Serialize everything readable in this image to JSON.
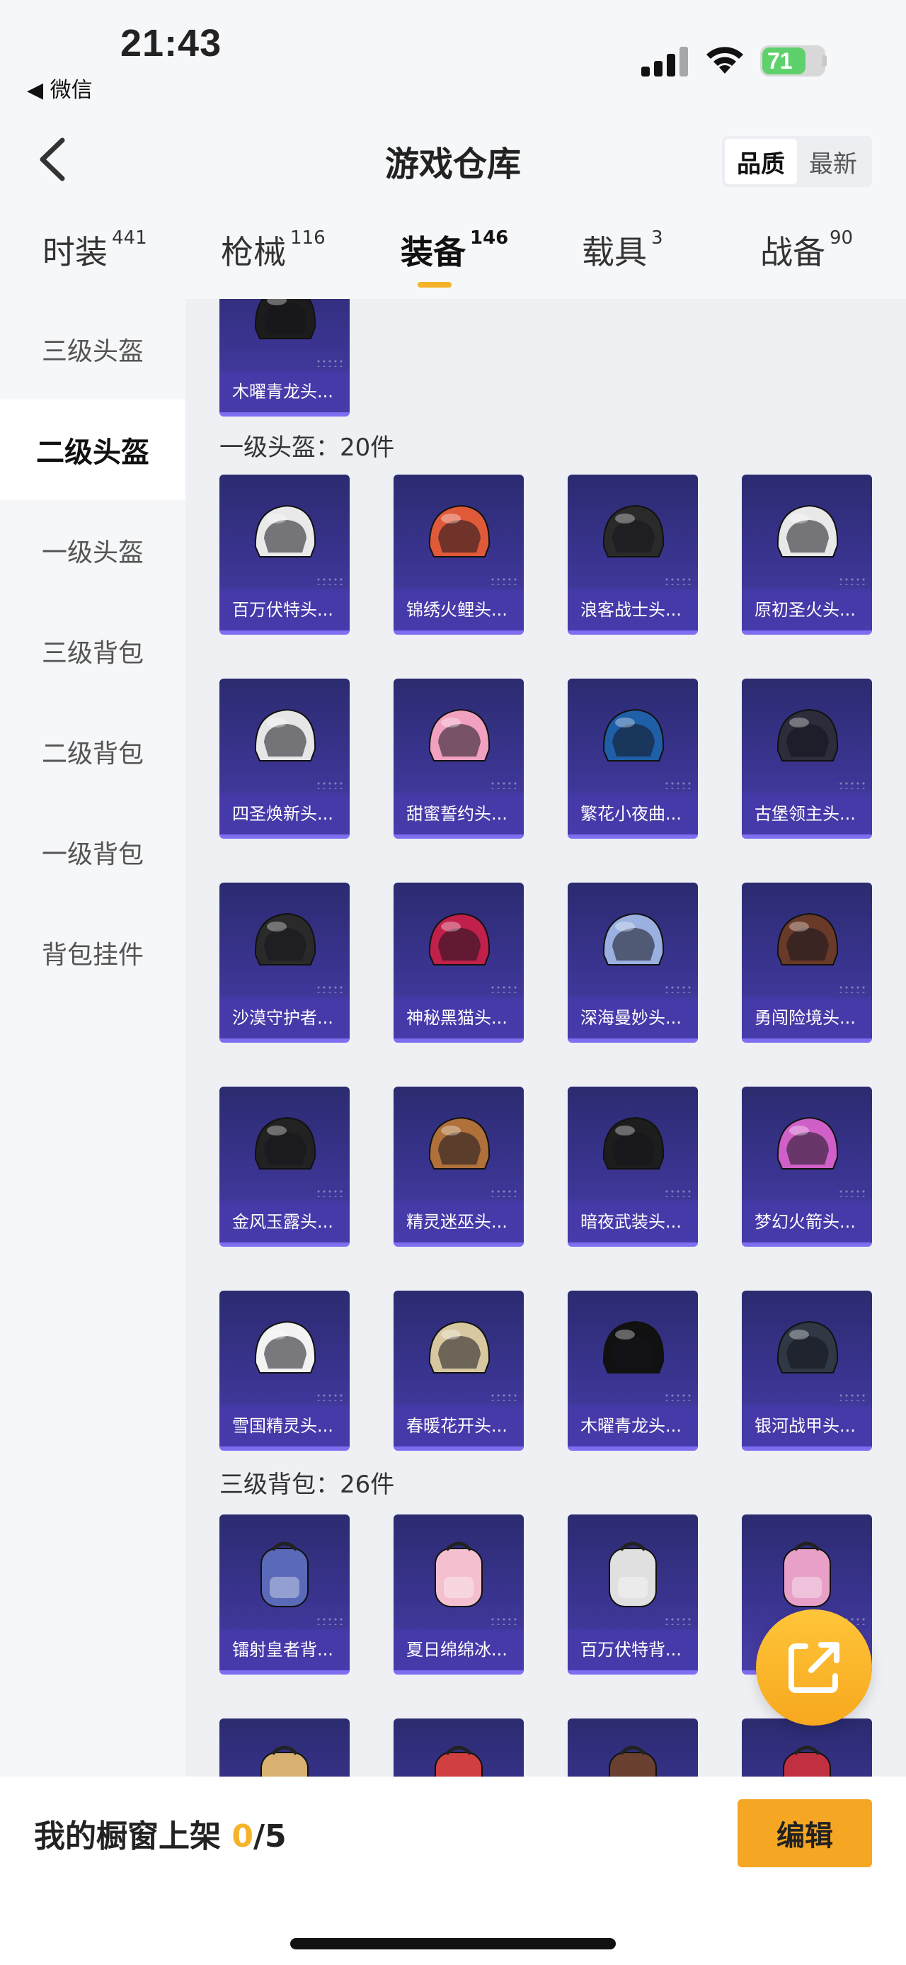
{
  "status_bar": {
    "time": "21:43",
    "back_app": "◀ 微信",
    "battery": "71",
    "battery_level": 0.71
  },
  "header": {
    "title": "游戏仓库",
    "sort_options": [
      "品质",
      "最新"
    ],
    "sort_active": "品质"
  },
  "tabs": [
    {
      "label": "时装",
      "count": "441"
    },
    {
      "label": "枪械",
      "count": "116"
    },
    {
      "label": "装备",
      "count": "146",
      "active": true
    },
    {
      "label": "载具",
      "count": "3"
    },
    {
      "label": "战备",
      "count": "90"
    }
  ],
  "sidebar": {
    "items": [
      "三级头盔",
      "二级头盔",
      "一级头盔",
      "三级背包",
      "二级背包",
      "一级背包",
      "背包挂件"
    ],
    "active": "二级头盔"
  },
  "sections": [
    {
      "title": "",
      "items": [
        "木曜青龙头..."
      ]
    },
    {
      "title": "一级头盔：20件",
      "items": [
        "百万伏特头...",
        "锦绣火鲤头...",
        "浪客战士头...",
        "原初圣火头...",
        "四圣焕新头...",
        "甜蜜誓约头...",
        "繁花小夜曲...",
        "古堡领主头...",
        "沙漠守护者...",
        "神秘黑猫头...",
        "深海曼妙头...",
        "勇闯险境头...",
        "金风玉露头...",
        "精灵迷巫头...",
        "暗夜武装头...",
        "梦幻火箭头...",
        "雪国精灵头...",
        "春暖花开头...",
        "木曜青龙头...",
        "银河战甲头..."
      ]
    },
    {
      "title": "三级背包：26件",
      "items": [
        "镭射皇者背...",
        "夏日绵绵冰...",
        "百万伏特背...",
        "",
        "",
        "",
        "",
        ""
      ]
    }
  ],
  "item_colors": [
    "#1c1c1c",
    "#e9e9e9",
    "#e05a3a",
    "#2a2a2a",
    "#e8e8e8",
    "#e6e6e6",
    "#f2a0c0",
    "#1f5fa8",
    "#2c2c3a",
    "#2a2a2a",
    "#c0204a",
    "#9ab0e0",
    "#6a3a28",
    "#222222",
    "#b0703a",
    "#1d1d1d",
    "#d060c8",
    "#f2f2f2",
    "#d8c8a0",
    "#111111",
    "#303846",
    "#5a6ab8",
    "#f4c0d0",
    "#e0e0e0",
    "#e8a0c8",
    "#d8b070",
    "#d04040",
    "#6a4030",
    "#c03040"
  ],
  "bottom_bar": {
    "label": "我的橱窗上架 ",
    "count": "0",
    "total": "/5",
    "edit_label": "编辑"
  },
  "icons": {
    "back": "chevron-left-icon",
    "share": "share-external-icon",
    "signal": "signal-icon",
    "wifi": "wifi-icon",
    "battery": "battery-icon"
  },
  "accent_color": "#f5b32a"
}
